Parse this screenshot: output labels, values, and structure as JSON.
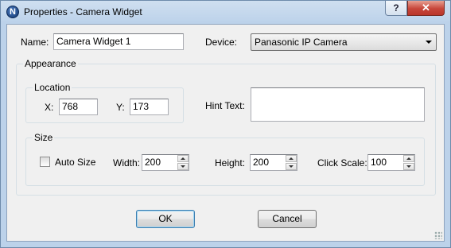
{
  "window": {
    "title": "Properties - Camera Widget",
    "app_icon_letter": "N",
    "help_glyph": "?",
    "close_glyph": "✕"
  },
  "form": {
    "name_label": "Name:",
    "name_value": "Camera Widget 1",
    "device_label": "Device:",
    "device_value": "Panasonic IP Camera"
  },
  "appearance": {
    "title": "Appearance",
    "location": {
      "title": "Location",
      "x_label": "X:",
      "x_value": "768",
      "y_label": "Y:",
      "y_value": "173"
    },
    "hint_label": "Hint Text:",
    "hint_value": "",
    "size": {
      "title": "Size",
      "auto_size_label": "Auto Size",
      "auto_size_checked": false,
      "width_label": "Width:",
      "width_value": "200",
      "height_label": "Height:",
      "height_value": "200",
      "click_scale_label": "Click Scale:",
      "click_scale_value": "100"
    }
  },
  "buttons": {
    "ok": "OK",
    "cancel": "Cancel"
  }
}
